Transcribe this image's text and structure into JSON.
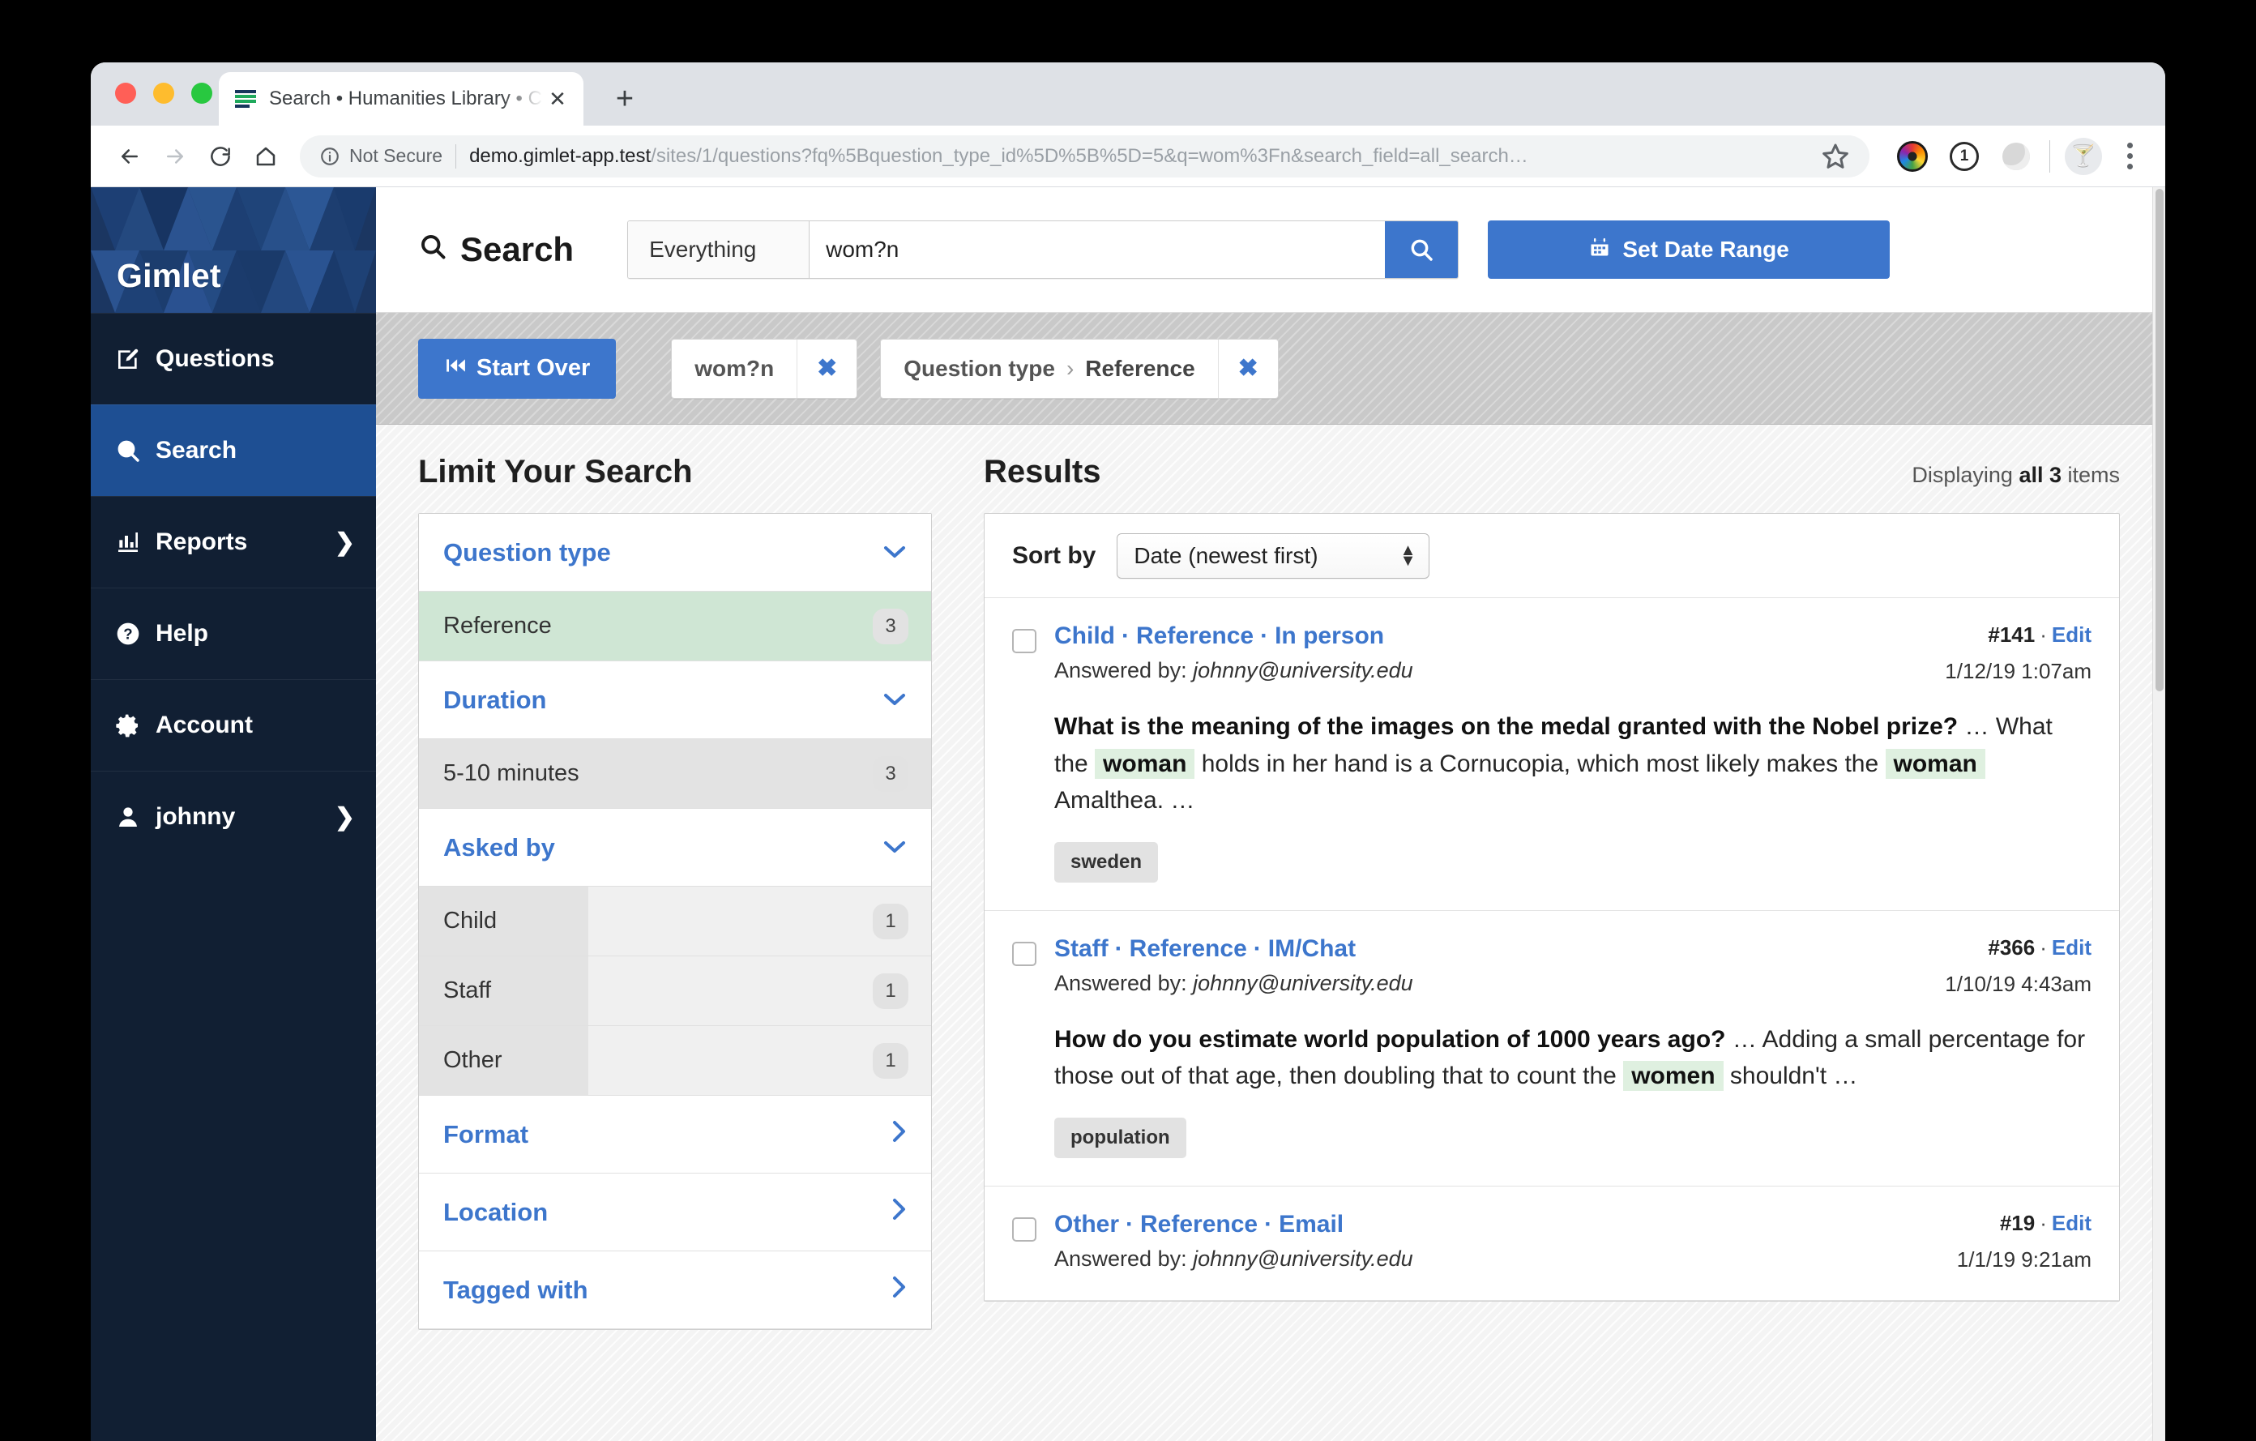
{
  "browser": {
    "tab_title": "Search • Humanities Library • C",
    "tab_close": "✕",
    "new_tab": "+",
    "security_label": "Not Secure",
    "url_host": "demo.gimlet-app.test",
    "url_path": "/sites/1/questions?fq%5Bquestion_type_id%5D%5B%5D=5&q=wom%3Fn&search_field=all_search…",
    "avatar_glyph": "🍸"
  },
  "sidebar": {
    "brand": "Gimlet",
    "items": [
      {
        "label": "Questions",
        "icon": "edit-square-icon",
        "chevron": "",
        "active": false
      },
      {
        "label": "Search",
        "icon": "search-icon",
        "chevron": "",
        "active": true
      },
      {
        "label": "Reports",
        "icon": "bar-chart-icon",
        "chevron": "❯",
        "active": false
      },
      {
        "label": "Help",
        "icon": "question-circle-icon",
        "chevron": "",
        "active": false
      },
      {
        "label": "Account",
        "icon": "gear-icon",
        "chevron": "",
        "active": false
      },
      {
        "label": "johnny",
        "icon": "user-icon",
        "chevron": "❯",
        "active": false
      }
    ]
  },
  "search": {
    "title": "Search",
    "scope": "Everything",
    "query": "wom?n",
    "placeholder": "",
    "date_range_button": "Set Date Range"
  },
  "filterbar": {
    "start_over": "Start Over",
    "chips": [
      {
        "label": "",
        "separator": "",
        "value": "wom?n",
        "remove": "✖"
      },
      {
        "label": "Question type",
        "separator": "›",
        "value": "Reference",
        "remove": "✖"
      }
    ]
  },
  "limit_panel": {
    "heading": "Limit Your Search",
    "facets": [
      {
        "name": "Question type",
        "caret": "chevron-down-icon",
        "rows": [
          {
            "label": "Reference",
            "count": "3",
            "state": "selected",
            "fill": 100
          }
        ]
      },
      {
        "name": "Duration",
        "caret": "chevron-down-icon",
        "rows": [
          {
            "label": "5-10 minutes",
            "count": "3",
            "state": "plain",
            "fill": 100
          }
        ]
      },
      {
        "name": "Asked by",
        "caret": "chevron-down-icon",
        "rows": [
          {
            "label": "Child",
            "count": "1",
            "state": "bar",
            "fill": 33
          },
          {
            "label": "Staff",
            "count": "1",
            "state": "bar",
            "fill": 33
          },
          {
            "label": "Other",
            "count": "1",
            "state": "bar",
            "fill": 33
          }
        ]
      },
      {
        "name": "Format",
        "caret": "chevron-right-icon",
        "rows": []
      },
      {
        "name": "Location",
        "caret": "chevron-right-icon",
        "rows": []
      },
      {
        "name": "Tagged with",
        "caret": "chevron-right-icon",
        "rows": []
      }
    ]
  },
  "results": {
    "heading": "Results",
    "displaying_prefix": "Displaying ",
    "displaying_count": "all 3",
    "displaying_suffix": " items",
    "sort_label": "Sort by",
    "sort_value": "Date (newest first)",
    "items": [
      {
        "asked_by": "Child",
        "question_type": "Reference",
        "format": "In person",
        "answered_by_label": "Answered by:",
        "answered_by": "johnny@university.edu",
        "id": "#141",
        "edit": "Edit",
        "date": "1/12/19 1:07am",
        "snippet_bold": "What is the meaning of the images on the medal granted with the Nobel prize?",
        "snippet_ellipsis": "…",
        "snippet_pre": "What the ",
        "highlight_1": "woman",
        "snippet_mid": " holds in her hand is a Cornucopia, which most likely makes the ",
        "highlight_2": "woman",
        "snippet_post": " Amalthea. …",
        "tags": [
          "sweden"
        ]
      },
      {
        "asked_by": "Staff",
        "question_type": "Reference",
        "format": "IM/Chat",
        "answered_by_label": "Answered by:",
        "answered_by": "johnny@university.edu",
        "id": "#366",
        "edit": "Edit",
        "date": "1/10/19 4:43am",
        "snippet_bold": "How do you estimate world population of 1000 years ago?",
        "snippet_ellipsis": "…",
        "snippet_pre": " Adding a small percentage for those out of that age, then doubling that to count the ",
        "highlight_1": "women",
        "snippet_mid": " shouldn't …",
        "highlight_2": "",
        "snippet_post": "",
        "tags": [
          "population"
        ]
      },
      {
        "asked_by": "Other",
        "question_type": "Reference",
        "format": "Email",
        "answered_by_label": "Answered by:",
        "answered_by": "johnny@university.edu",
        "id": "#19",
        "edit": "Edit",
        "date": "1/1/19 9:21am",
        "snippet_bold": "",
        "snippet_ellipsis": "",
        "snippet_pre": "",
        "highlight_1": "",
        "snippet_mid": "",
        "highlight_2": "",
        "snippet_post": "",
        "tags": []
      }
    ]
  },
  "colors": {
    "brand_navy": "#111f33",
    "brand_blue": "#1e4f93",
    "accent_blue": "#3d76cc",
    "selected_green": "#cfe6d4",
    "highlight_green": "#dff0e0"
  }
}
